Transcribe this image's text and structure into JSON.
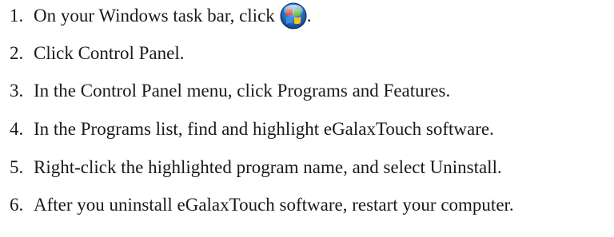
{
  "steps": [
    {
      "number": "1.",
      "text": "On your Windows task bar, click",
      "icon": "windows-start-icon",
      "trail": "."
    },
    {
      "number": "2.",
      "text": "Click Control Panel."
    },
    {
      "number": "3.",
      "text": "In the Control Panel menu, click Programs and Features."
    },
    {
      "number": "4.",
      "text": "In the Programs list, find and highlight eGalaxTouch software."
    },
    {
      "number": "5.",
      "text": "Right-click the highlighted program name, and select Uninstall."
    },
    {
      "number": "6.",
      "text": "After you uninstall eGalaxTouch software, restart your computer."
    }
  ],
  "colors": {
    "text": "#1a1a1a",
    "start_orb_blue": "#1c63b7",
    "flag_red": "#e8452c",
    "flag_green": "#6cbd2a",
    "flag_blue": "#3a8fe0",
    "flag_yellow": "#f7c21b"
  }
}
